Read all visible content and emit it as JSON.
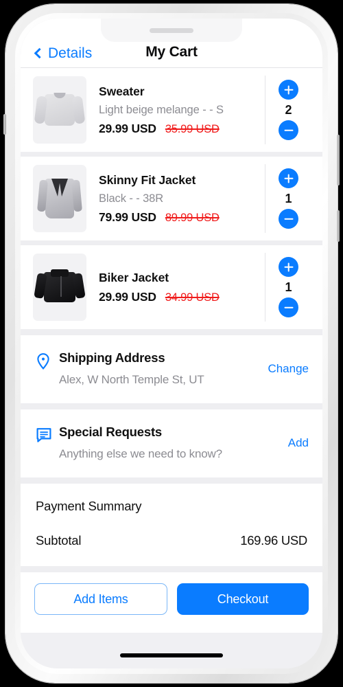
{
  "nav": {
    "back_label": "Details",
    "title": "My Cart"
  },
  "items": [
    {
      "name": "Sweater",
      "variant": "Light beige melange -  - S",
      "price": "29.99 USD",
      "original_price": "35.99 USD",
      "quantity": "2",
      "thumb": "sweater-gray"
    },
    {
      "name": "Skinny Fit Jacket",
      "variant": "Black -  - 38R",
      "price": "79.99 USD",
      "original_price": "89.99 USD",
      "quantity": "1",
      "thumb": "blazer-gray"
    },
    {
      "name": "Biker Jacket",
      "variant": "",
      "price": "29.99 USD",
      "original_price": "34.99 USD",
      "quantity": "1",
      "thumb": "biker-black"
    }
  ],
  "shipping": {
    "icon": "location-pin-icon",
    "title": "Shipping Address",
    "address": "Alex, W North Temple St, UT",
    "action": "Change"
  },
  "special_requests": {
    "icon": "chat-bubble-icon",
    "title": "Special Requests",
    "placeholder": "Anything else we need to know?",
    "action": "Add"
  },
  "payment": {
    "title": "Payment Summary",
    "subtotal_label": "Subtotal",
    "subtotal_value": "169.96 USD"
  },
  "footer": {
    "add_items": "Add Items",
    "checkout": "Checkout"
  },
  "colors": {
    "accent": "#0a7cff",
    "sale_red": "#f01b1b",
    "muted": "#8c8c92",
    "page_bg": "#f0f0f3"
  }
}
